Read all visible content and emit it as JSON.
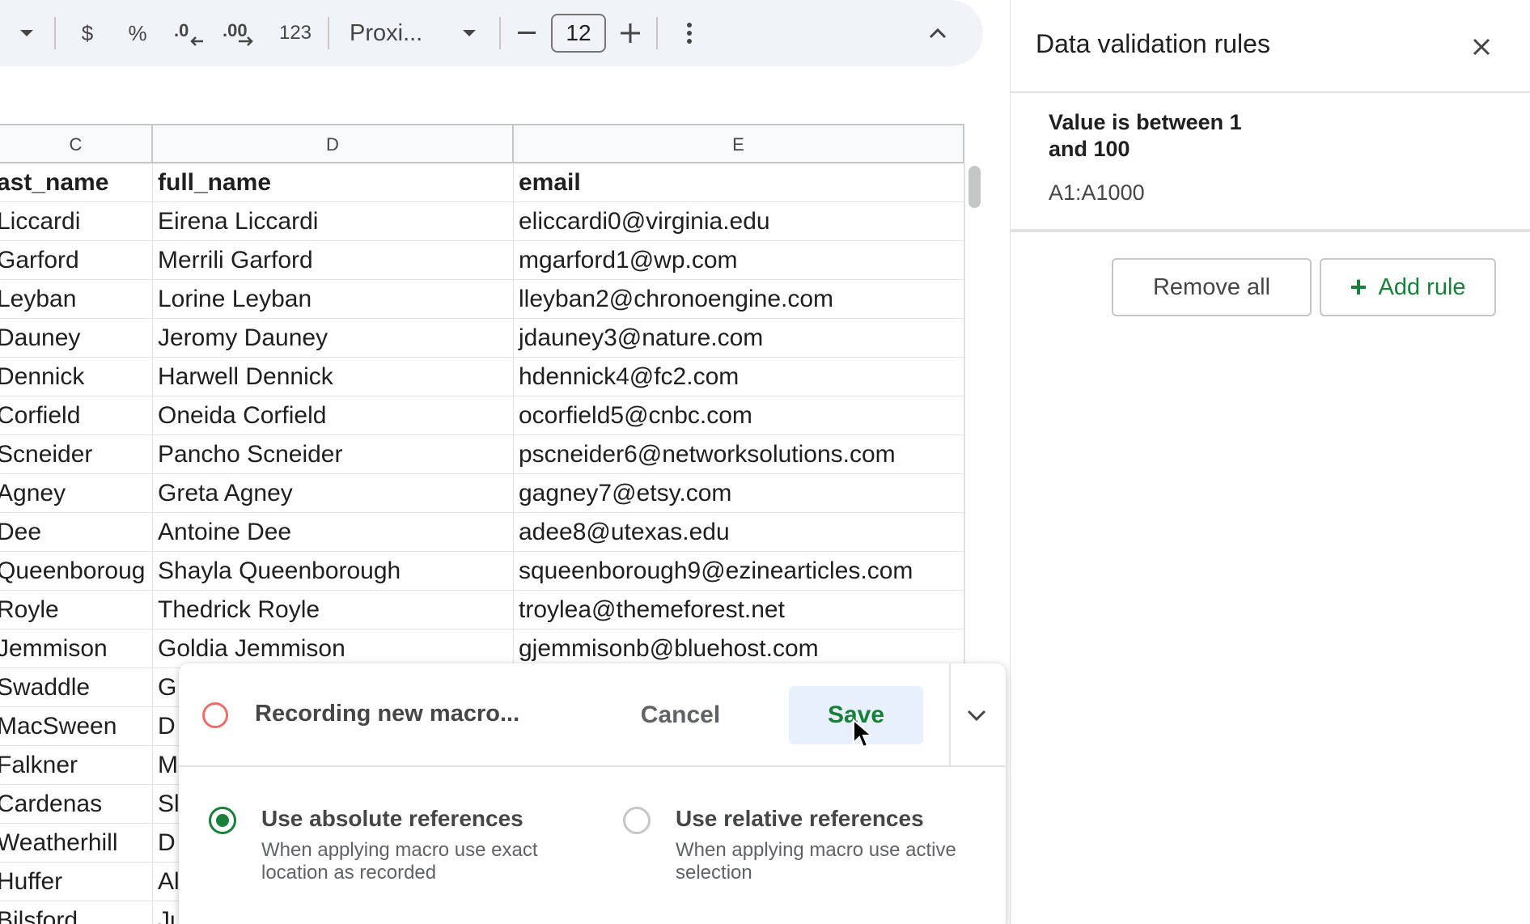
{
  "toolbar": {
    "currency": "$",
    "percent": "%",
    "decimal_decrease": ".0",
    "decimal_increase": ".00",
    "number_format": "123",
    "font_name": "Proxi...",
    "font_size": "12"
  },
  "grid": {
    "columns": [
      "C",
      "D",
      "E"
    ],
    "header_row": {
      "c": "ast_name",
      "d": "full_name",
      "e": "email"
    },
    "rows": [
      {
        "c": "Liccardi",
        "d": "Eirena Liccardi",
        "e": "eliccardi0@virginia.edu"
      },
      {
        "c": "Garford",
        "d": "Merrili Garford",
        "e": "mgarford1@wp.com"
      },
      {
        "c": "Leyban",
        "d": "Lorine Leyban",
        "e": "lleyban2@chronoengine.com"
      },
      {
        "c": "Dauney",
        "d": "Jeromy Dauney",
        "e": "jdauney3@nature.com"
      },
      {
        "c": "Dennick",
        "d": "Harwell Dennick",
        "e": "hdennick4@fc2.com"
      },
      {
        "c": "Corfield",
        "d": "Oneida Corfield",
        "e": "ocorfield5@cnbc.com"
      },
      {
        "c": "Scneider",
        "d": "Pancho Scneider",
        "e": "pscneider6@networksolutions.com"
      },
      {
        "c": "Agney",
        "d": "Greta Agney",
        "e": "gagney7@etsy.com"
      },
      {
        "c": "Dee",
        "d": "Antoine Dee",
        "e": "adee8@utexas.edu"
      },
      {
        "c": "Queenboroug",
        "d": "Shayla Queenborough",
        "e": "squeenborough9@ezinearticles.com"
      },
      {
        "c": "Royle",
        "d": "Thedrick Royle",
        "e": "troylea@themeforest.net"
      },
      {
        "c": "Jemmison",
        "d": "Goldia Jemmison",
        "e": "gjemmisonb@bluehost.com"
      },
      {
        "c": "Swaddle",
        "d": "G",
        "e": ""
      },
      {
        "c": "MacSween",
        "d": "D",
        "e": ""
      },
      {
        "c": "Falkner",
        "d": "M",
        "e": ""
      },
      {
        "c": "Cardenas",
        "d": "Sl",
        "e": ""
      },
      {
        "c": "Weatherhill",
        "d": "D",
        "e": ""
      },
      {
        "c": "Huffer",
        "d": "Al",
        "e": ""
      },
      {
        "c": "Bilsford",
        "d": "Ju",
        "e": ""
      }
    ]
  },
  "panel": {
    "title": "Data validation rules",
    "rule": {
      "title": "Value is between 1 and 100",
      "range": "A1:A1000"
    },
    "remove_all_label": "Remove all",
    "add_rule_label": "Add rule"
  },
  "macro": {
    "status": "Recording new macro...",
    "cancel_label": "Cancel",
    "save_label": "Save",
    "absolute": {
      "title": "Use absolute references",
      "desc": "When applying macro use exact location as recorded",
      "selected": true
    },
    "relative": {
      "title": "Use relative references",
      "desc": "When applying macro use active selection",
      "selected": false
    }
  },
  "colors": {
    "accent_green": "#188038",
    "record_red": "#ea6f6a",
    "save_bg": "#e8f0fe",
    "toolbar_bg": "#f0f4f9"
  }
}
